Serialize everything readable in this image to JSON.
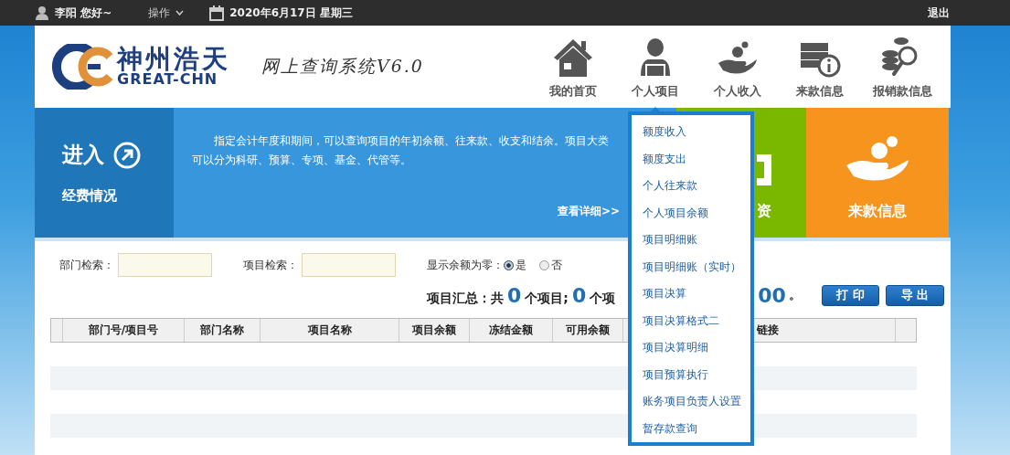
{
  "top_bar": {
    "greeting": "李阳 您好~",
    "menu": "操作",
    "date": "2020年6月17日 星期三",
    "logout": "退出"
  },
  "header": {
    "logo_cn": "神州浩天",
    "logo_en": "GREAT-CHN",
    "system_title": "网上查询系统V6.0",
    "nav": [
      {
        "label": "我的首页",
        "kind": "home",
        "selected": false
      },
      {
        "label": "个人项目",
        "kind": "person",
        "selected": true
      },
      {
        "label": "个人收入",
        "kind": "income",
        "selected": false
      },
      {
        "label": "来款信息",
        "kind": "money",
        "selected": false
      },
      {
        "label": "报销款信息",
        "kind": "search",
        "selected": false
      }
    ]
  },
  "banner": {
    "enter_title": "进入",
    "enter_subtitle": "经费情况",
    "description": "指定会计年度和期间，可以查询项目的年初余额、往来款、收支和结余。项目大类可以分为科研、预算、专项、基金、代管等。",
    "details_link": "查看详细>>",
    "tiles": [
      {
        "label": "资",
        "kind": "green"
      },
      {
        "label": "来款信息",
        "kind": "orange"
      }
    ]
  },
  "filters": {
    "dept_label": "部门检索：",
    "project_label": "项目检索：",
    "zero_label": "显示余额为零：",
    "options": [
      {
        "label": "是",
        "selected": true
      },
      {
        "label": "否",
        "selected": false
      }
    ]
  },
  "summary": {
    "text_start": "项目汇总：共",
    "count1": "0",
    "text_mid": "个项目;",
    "count2": "0",
    "text_cut": "个项",
    "amount_tail": "00",
    "end": "。"
  },
  "buttons": [
    "打 印",
    "导 出"
  ],
  "table": {
    "columns": [
      "部门号/项目号",
      "部门名称",
      "项目名称",
      "项目余额",
      "冻结金额",
      "可用余额",
      "链接"
    ]
  },
  "dropdown": {
    "items": [
      "额度收入",
      "额度支出",
      "个人往来款",
      "个人项目余额",
      "项目明细账",
      "项目明细账（实时）",
      "项目决算",
      "项目决算格式二",
      "项目决算明细",
      "项目预算执行",
      "账务项目负责人设置",
      "暂存款查询"
    ]
  }
}
